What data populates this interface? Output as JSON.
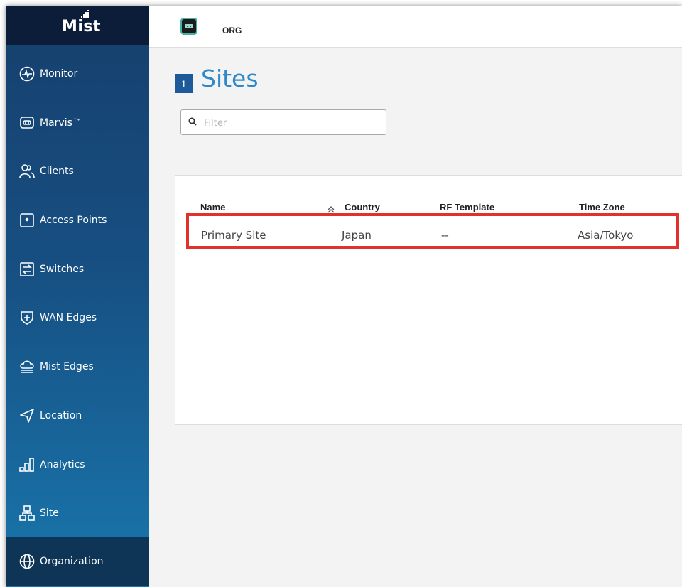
{
  "brand": {
    "logo_text": "Mist"
  },
  "header": {
    "org_label": "ORG"
  },
  "sidebar": {
    "items": [
      {
        "label": "Monitor",
        "icon": "monitor-icon"
      },
      {
        "label": "Marvis™",
        "icon": "marvis-icon"
      },
      {
        "label": "Clients",
        "icon": "clients-icon"
      },
      {
        "label": "Access Points",
        "icon": "access-point-icon"
      },
      {
        "label": "Switches",
        "icon": "switches-icon"
      },
      {
        "label": "WAN Edges",
        "icon": "wan-edge-icon"
      },
      {
        "label": "Mist Edges",
        "icon": "mist-edge-icon"
      },
      {
        "label": "Location",
        "icon": "location-icon"
      },
      {
        "label": "Analytics",
        "icon": "analytics-icon"
      },
      {
        "label": "Site",
        "icon": "site-icon"
      },
      {
        "label": "Organization",
        "icon": "organization-icon",
        "active": true
      }
    ]
  },
  "page": {
    "count": "1",
    "title": "Sites",
    "filter_placeholder": "Filter"
  },
  "table": {
    "columns": [
      "Name",
      "Country",
      "RF Template",
      "Time Zone"
    ],
    "sorted_column": "Name",
    "rows": [
      {
        "name": "Primary Site",
        "country": "Japan",
        "rf_template": "--",
        "time_zone": "Asia/Tokyo"
      }
    ]
  },
  "colors": {
    "sidebar_top": "#163f6c",
    "sidebar_bottom": "#1877ad",
    "title_blue": "#2f89c9",
    "badge_blue": "#1c5a99",
    "highlight_red": "#e2302d"
  }
}
